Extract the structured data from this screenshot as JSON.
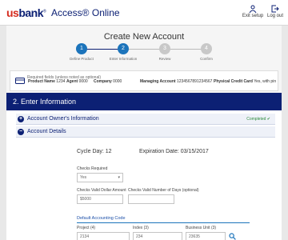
{
  "header": {
    "logo_us": "us",
    "logo_bank": "bank",
    "logo_reg": "®",
    "app_title": "Access® Online",
    "exit_setup": "Exit setup",
    "log_out": "Log out"
  },
  "page_title": "Create New Account",
  "steps": [
    {
      "num": "1",
      "label": "Define Product",
      "done": true
    },
    {
      "num": "2",
      "label": "Enter Information",
      "done": true
    },
    {
      "num": "3",
      "label": "Review",
      "done": false
    },
    {
      "num": "4",
      "label": "Confirm",
      "done": false
    }
  ],
  "infobar": {
    "product_label": "Product Name",
    "product_value": "1234",
    "agent_label": "Agent",
    "agent_value": "0000",
    "company_label": "Company",
    "company_value": "0000",
    "managing_label": "Managing Account",
    "managing_value": "1234567891234567",
    "card_label": "Physical Credit Card",
    "card_value": "Yes, with pin"
  },
  "section_title": "2. Enter Information",
  "accordions": {
    "owner": "Account Owner's Information",
    "owner_status": "Completed ✔",
    "details": "Account Details"
  },
  "required_note": "Required fields (unless noted as optional)",
  "cycle_day": "Cycle Day: 12",
  "expiration": "Expiration Date: 03/15/2017",
  "fields": {
    "checks_required_label": "Checks Required",
    "checks_required_value": "Yes",
    "dollar_amount_label": "Checks Valid Dollar Amount",
    "dollar_amount_value": "$5000",
    "num_days_label": "Checks Valid Number of Days (optional)",
    "num_days_value": ""
  },
  "accounting": {
    "title": "Default Accounting Code",
    "project_label": "Project (4)",
    "project_value": "2134",
    "index_label": "Index (3)",
    "index_value": "234",
    "bu_label": "Business Unit (3)",
    "bu_value": "23635"
  },
  "colors": {
    "brand_navy": "#0c2074",
    "brand_red": "#d52b1e",
    "step_active": "#1c74bb",
    "completed_green": "#2c8c3c"
  }
}
